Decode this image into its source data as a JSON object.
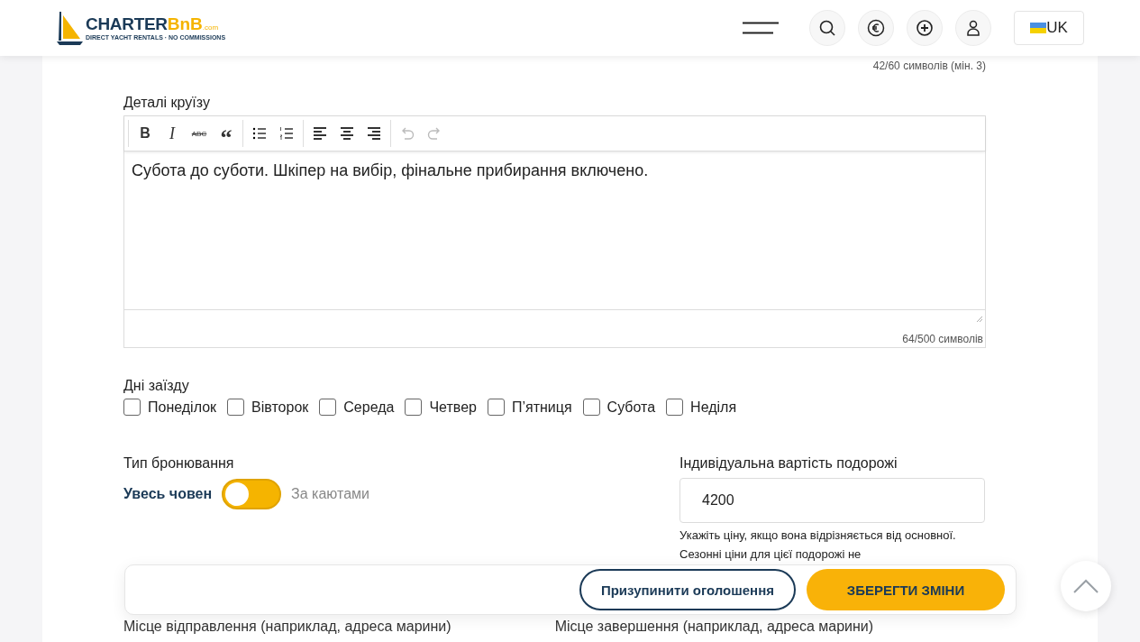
{
  "header": {
    "logo": {
      "brand": "CHARTER",
      "brand_accent": "BnB",
      "domain": ".com",
      "tagline": "DIRECT YACHT RENTALS · NO COMMISSIONS"
    },
    "icon_buttons": [
      {
        "kind": "search"
      },
      {
        "kind": "currency"
      },
      {
        "kind": "add"
      },
      {
        "kind": "account"
      }
    ],
    "language": "UK"
  },
  "title_counter": "42/60 символів (мін. 3)",
  "cruise_details": {
    "label": "Деталі круїзу",
    "toolbar": [
      {
        "kind": "bold",
        "glyph": "B"
      },
      {
        "kind": "italic",
        "glyph": "I"
      },
      {
        "kind": "strike",
        "glyph": "ABC"
      },
      {
        "kind": "quote",
        "glyph": "“"
      },
      {
        "kind": "bullets"
      },
      {
        "kind": "numbers"
      },
      {
        "kind": "align-left"
      },
      {
        "kind": "align-center"
      },
      {
        "kind": "align-right"
      },
      {
        "kind": "undo",
        "disabled": true
      },
      {
        "kind": "redo",
        "disabled": true
      }
    ],
    "text": "Субота до суботи. Шкіпер на вибір, фінальне прибирання включено.",
    "counter": "64/500 символів"
  },
  "checkin_days": {
    "label": "Дні заїзду",
    "days": [
      {
        "label": "Понеділок",
        "checked": false
      },
      {
        "label": "Вівторок",
        "checked": false
      },
      {
        "label": "Середа",
        "checked": false
      },
      {
        "label": "Четвер",
        "checked": false
      },
      {
        "label": "П’ятниця",
        "checked": false
      },
      {
        "label": "Субота",
        "checked": false
      },
      {
        "label": "Неділя",
        "checked": false
      }
    ]
  },
  "booking_type": {
    "label": "Тип бронювання",
    "options": [
      {
        "label": "Увесь човен",
        "selected": true
      },
      {
        "label": "За каютами",
        "selected": false
      }
    ]
  },
  "custom_price": {
    "label": "Індивідуальна вартість подорожі",
    "value": "4200",
    "hints": [
      "Укажіть ціну, якщо вона відрізняється від основної.",
      "Сезонні ціни для цієї подорожі не"
    ]
  },
  "location_labels": [
    "Місце відправлення (наприклад, адреса марини)",
    "Місце завершення (наприклад, адреса марини)"
  ],
  "actions": [
    {
      "label": "Призупинити оголошення",
      "kind": "outline"
    },
    {
      "label": "ЗБЕРЕГТИ ЗМІНИ",
      "kind": "primary"
    }
  ]
}
